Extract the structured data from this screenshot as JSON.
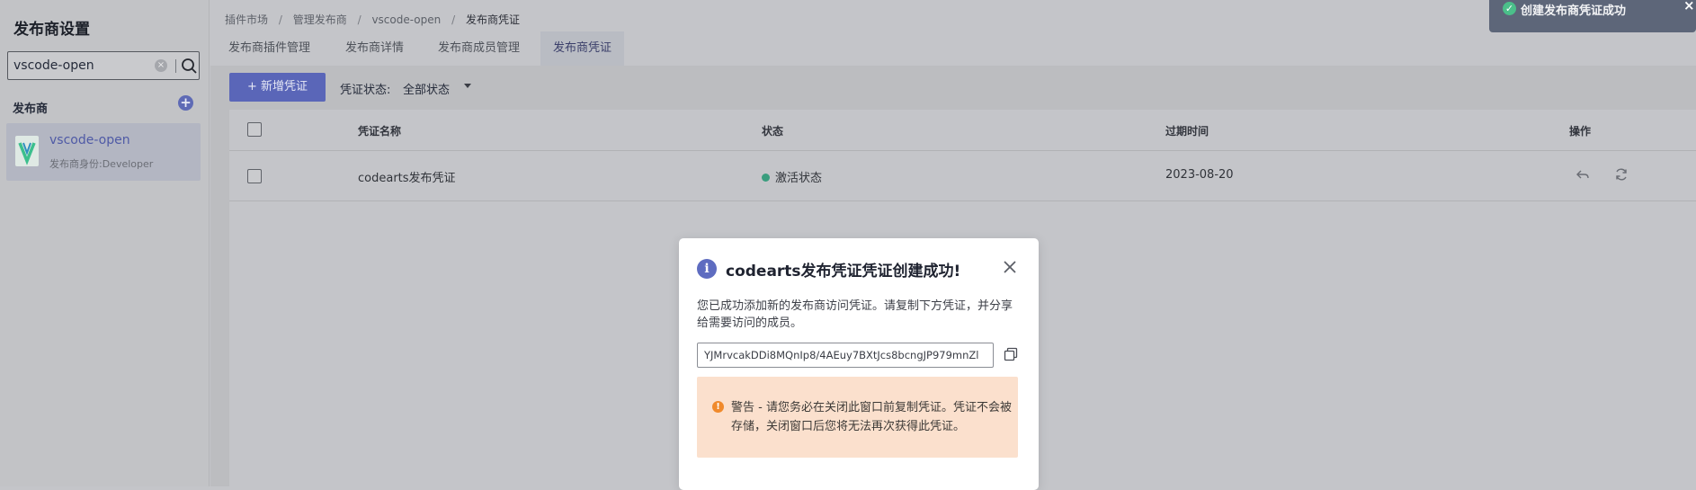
{
  "sidebar": {
    "title": "发布商设置",
    "search": {
      "value": "vscode-open",
      "clear_glyph": "×"
    },
    "section_label": "发布商",
    "add_glyph": "+",
    "publisher": {
      "name": "vscode-open",
      "role": "发布商身份:Developer"
    }
  },
  "breadcrumb": [
    "插件市场",
    "/",
    "管理发布商",
    "/",
    "vscode-open",
    "/",
    "发布商凭证"
  ],
  "tabs": [
    {
      "label": "发布商插件管理"
    },
    {
      "label": "发布商详情"
    },
    {
      "label": "发布商成员管理"
    },
    {
      "label": "发布商凭证",
      "active": true
    }
  ],
  "toolbar": {
    "new_button": "+ 新增凭证",
    "filter_label": "凭证状态:",
    "filter_value": "全部状态"
  },
  "table": {
    "headers": [
      "凭证名称",
      "状态",
      "过期时间",
      "操作"
    ],
    "rows": [
      {
        "name": "codearts发布凭证",
        "status": "激活状态",
        "expires": "2023-08-20"
      }
    ]
  },
  "modal": {
    "info_glyph": "i",
    "title": "codearts发布凭证凭证创建成功!",
    "description": "您已成功添加新的发布商访问凭证。请复制下方凭证，并分享给需要访问的成员。",
    "token": "YJMrvcakDDi8MQnIp8/4AEuy7BXtJcs8bcngJP979mnZl",
    "warning_glyph": "!",
    "warning": "警告 - 请您务必在关闭此窗口前复制凭证。凭证不会被存储，关闭窗口后您将无法再次获得此凭证。"
  },
  "toast": {
    "text": "创建发布商凭证成功",
    "check_glyph": "✓",
    "close_glyph": "×"
  },
  "colors": {
    "primary": "#5a66b8",
    "success": "#3a9d7e",
    "warning_bg": "#fbe0cd",
    "warning_icon": "#f08a2c",
    "toast_bg": "#5d6679"
  }
}
